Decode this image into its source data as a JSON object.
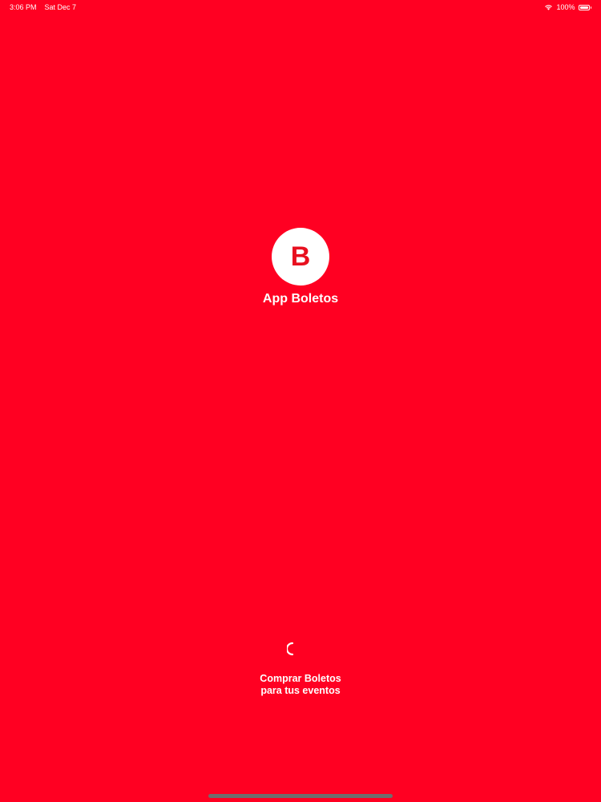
{
  "status_bar": {
    "time": "3:06 PM",
    "date": "Sat Dec 7",
    "battery_percent": "100%",
    "battery_level": 1.0,
    "icons": [
      "wifi-icon",
      "battery-icon"
    ]
  },
  "app": {
    "logo_letter": "B",
    "title": "App Boletos"
  },
  "tagline": {
    "line1": "Comprar Boletos",
    "line2": "para tus eventos"
  },
  "colors": {
    "background": "#FF0022",
    "logo_circle": "#FFFFFF",
    "logo_letter": "#E8101F",
    "text": "#FFFFFF",
    "home_indicator": "#6E6E6E"
  }
}
